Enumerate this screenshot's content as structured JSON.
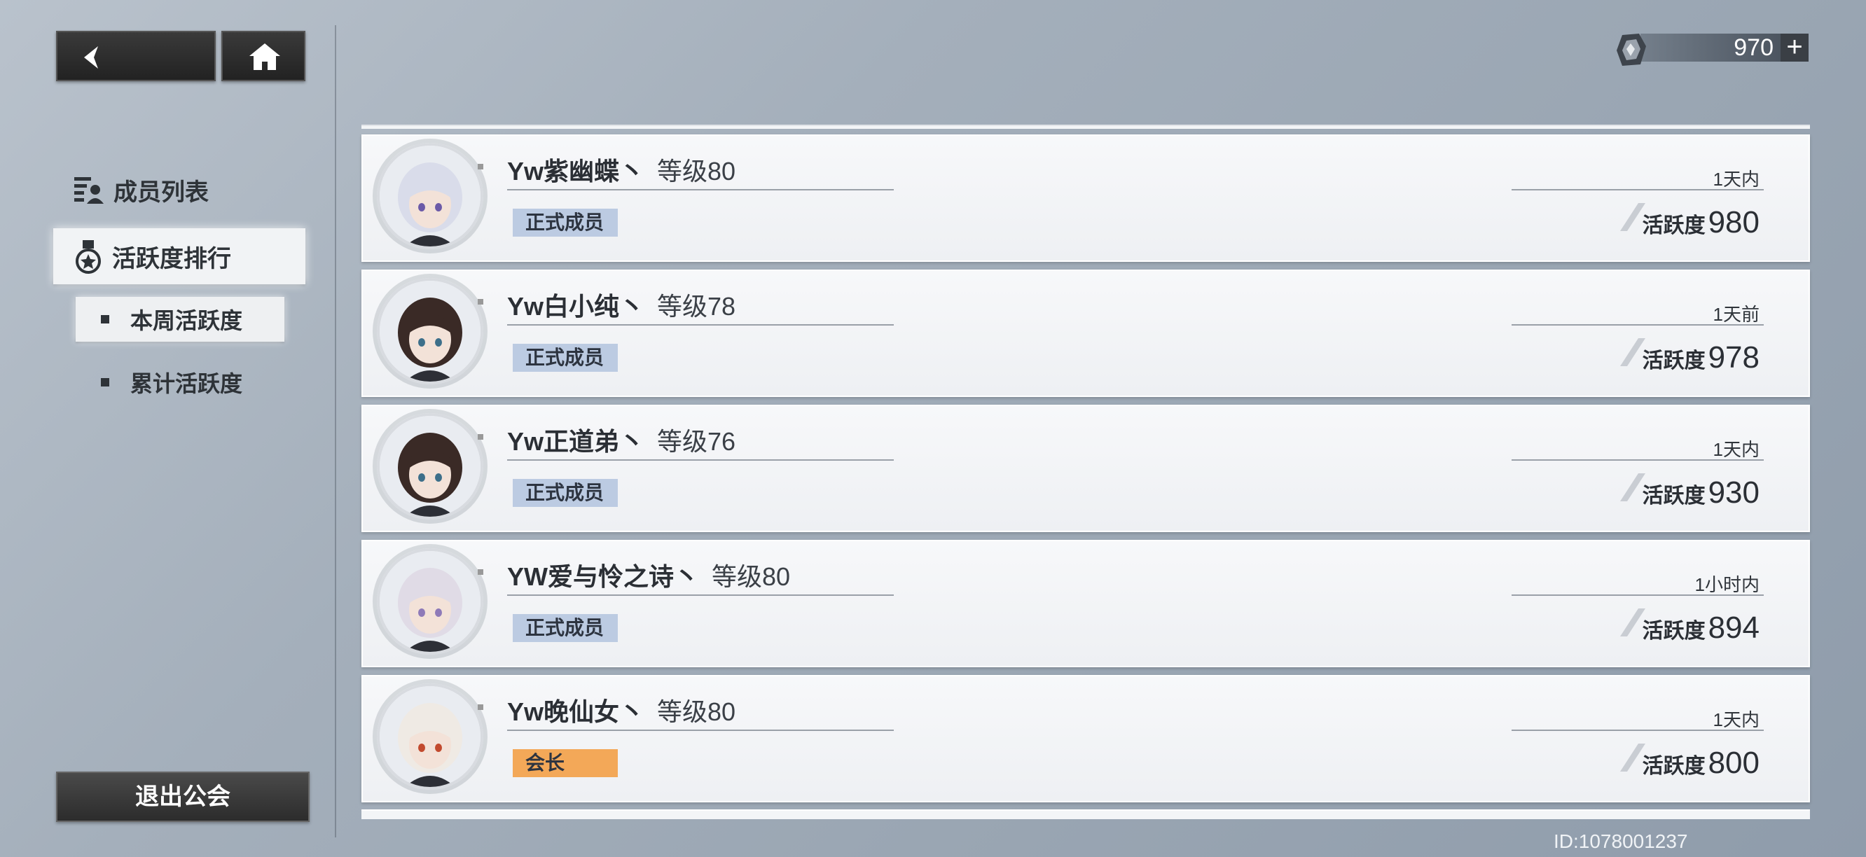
{
  "header": {
    "currency_value": "970",
    "currency_plus": "+"
  },
  "sidebar": {
    "members_label": "成员列表",
    "activity_label": "活跃度排行",
    "weekly_label": "本周活跃度",
    "total_label": "累计活跃度",
    "exit_label": "退出公会"
  },
  "members": [
    {
      "name": "Yw紫幽蝶丶",
      "level": "等级80",
      "role": "正式成员",
      "role_type": "member",
      "time": "1天内",
      "activity_label": "活跃度",
      "activity": "980"
    },
    {
      "name": "Yw白小纯丶",
      "level": "等级78",
      "role": "正式成员",
      "role_type": "member",
      "time": "1天前",
      "activity_label": "活跃度",
      "activity": "978"
    },
    {
      "name": "Yw正道弟丶",
      "level": "等级76",
      "role": "正式成员",
      "role_type": "member",
      "time": "1天内",
      "activity_label": "活跃度",
      "activity": "930"
    },
    {
      "name": "YW爱与怜之诗丶",
      "level": "等级80",
      "role": "正式成员",
      "role_type": "member",
      "time": "1小时内",
      "activity_label": "活跃度",
      "activity": "894"
    },
    {
      "name": "Yw晚仙女丶",
      "level": "等级80",
      "role": "会长",
      "role_type": "leader",
      "time": "1天内",
      "activity_label": "活跃度",
      "activity": "800"
    }
  ],
  "footer": {
    "guild_id": "ID:1078001237"
  },
  "colors": {
    "member_badge": "#bccbe2",
    "leader_badge": "#f3a858"
  }
}
